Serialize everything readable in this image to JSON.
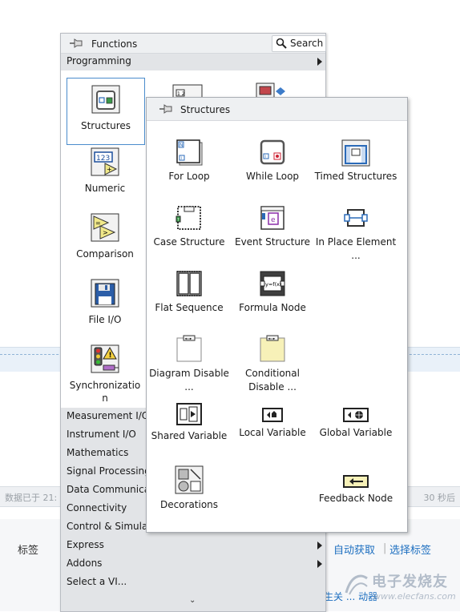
{
  "background": {
    "status_left": "数据已于 21:",
    "status_right": "30 秒后",
    "tag_label": "标签",
    "auto_fetch": "自动获取",
    "separator": "|",
    "select_tag": "选择标签",
    "partial_text": "生关 ... 动器",
    "watermark_cn": "电子发烧友",
    "watermark_en": "www.elecfans.com"
  },
  "functions_palette": {
    "title": "Functions",
    "search_label": "Search",
    "programming_label": "Programming",
    "categories": [
      {
        "label": "Structures",
        "icon": "structures-icon"
      },
      {
        "label": "Numeric",
        "icon": "numeric-icon"
      },
      {
        "label": "Comparison",
        "icon": "comparison-icon"
      },
      {
        "label": "File I/O",
        "icon": "file-io-icon"
      },
      {
        "label": "Synchronizatio n",
        "icon": "synchronization-icon"
      }
    ],
    "list": [
      {
        "label": "Measurement I/O",
        "submenu": false
      },
      {
        "label": "Instrument I/O",
        "submenu": false
      },
      {
        "label": "Mathematics",
        "submenu": false
      },
      {
        "label": "Signal Processing",
        "submenu": false
      },
      {
        "label": "Data Communica",
        "submenu": false
      },
      {
        "label": "Connectivity",
        "submenu": false
      },
      {
        "label": "Control & Simula",
        "submenu": false
      },
      {
        "label": "Express",
        "submenu": true
      },
      {
        "label": "Addons",
        "submenu": true
      },
      {
        "label": "Select a VI...",
        "submenu": false
      }
    ],
    "more_indicator": "⌄"
  },
  "structures_palette": {
    "title": "Structures",
    "items": [
      {
        "label": "For Loop",
        "icon": "for-loop-icon"
      },
      {
        "label": "While Loop",
        "icon": "while-loop-icon"
      },
      {
        "label": "Timed Structures",
        "icon": "timed-structures-icon"
      },
      {
        "label": "Case Structure",
        "icon": "case-structure-icon"
      },
      {
        "label": "Event Structure",
        "icon": "event-structure-icon"
      },
      {
        "label": "In Place Element ...",
        "icon": "in-place-element-icon"
      },
      {
        "label": "Flat Sequence",
        "icon": "flat-sequence-icon"
      },
      {
        "label": "Formula Node",
        "icon": "formula-node-icon"
      },
      {
        "label": "Diagram Disable ...",
        "icon": "diagram-disable-icon"
      },
      {
        "label": "Conditional Disable ...",
        "icon": "conditional-disable-icon"
      },
      {
        "label": "Shared Variable",
        "icon": "shared-variable-icon"
      },
      {
        "label": "Local Variable",
        "icon": "local-variable-icon"
      },
      {
        "label": "Global Variable",
        "icon": "global-variable-icon"
      },
      {
        "label": "Decorations",
        "icon": "decorations-icon"
      },
      {
        "label": "Feedback Node",
        "icon": "feedback-node-icon"
      }
    ]
  }
}
